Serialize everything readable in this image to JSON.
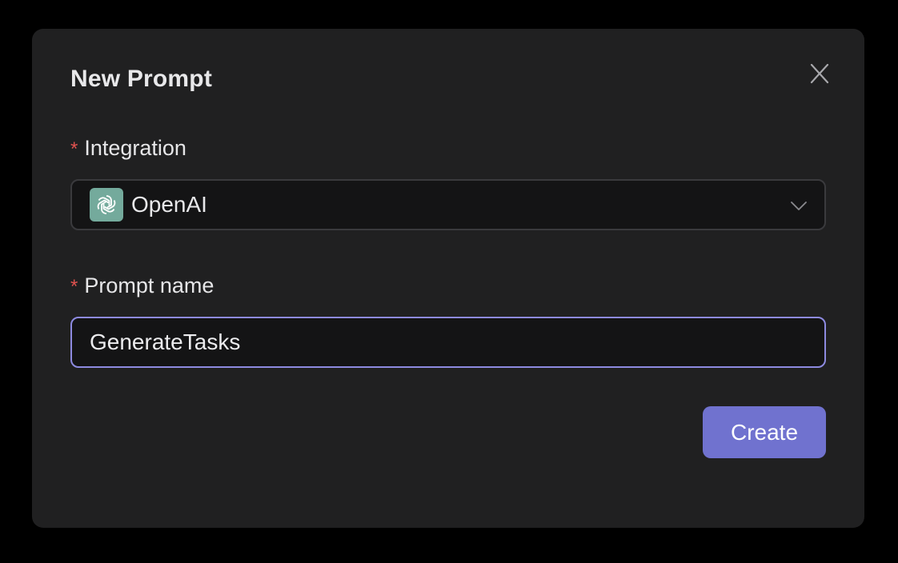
{
  "dialog": {
    "title": "New Prompt",
    "close_icon": "close-icon"
  },
  "fields": {
    "integration": {
      "required_marker": "*",
      "label": "Integration",
      "selected_value": "OpenAI",
      "logo_icon": "openai-logo-icon",
      "dropdown_icon": "chevron-down-icon"
    },
    "prompt_name": {
      "required_marker": "*",
      "label": "Prompt name",
      "value": "GenerateTasks"
    }
  },
  "actions": {
    "create_label": "Create"
  },
  "colors": {
    "background": "#000000",
    "dialog_bg": "#202021",
    "input_bg": "#141415",
    "accent": "#7072cf",
    "focus_border": "#8d8ae0",
    "required": "#e0524f",
    "openai_logo_bg": "#74aa9c"
  }
}
